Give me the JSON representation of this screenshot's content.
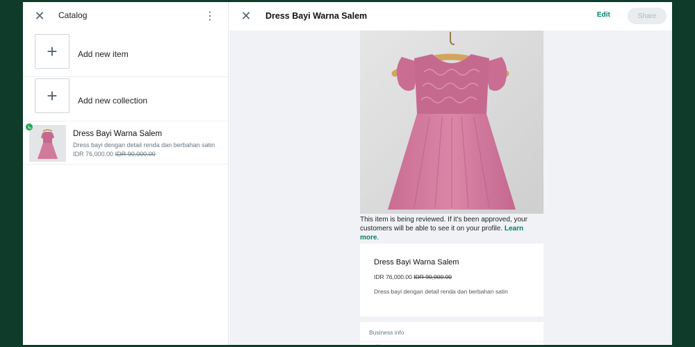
{
  "catalog": {
    "title": "Catalog",
    "add_item_label": "Add new item",
    "add_collection_label": "Add new collection",
    "items": [
      {
        "name": "Dress Bayi Warna Salem",
        "description": "Dress bayi dengan detail renda dan berbahan satin",
        "price": "IDR 76,000.00",
        "original_price": "IDR 90,000.00",
        "status": "under-review"
      }
    ]
  },
  "detail": {
    "title": "Dress Bayi Warna Salem",
    "edit_label": "Edit",
    "share_label": "Share",
    "review_notice": "This item is being reviewed. If it's been approved, your customers will be able to see it on your profile.",
    "learn_more": "Learn more",
    "notice_end": ".",
    "product_name": "Dress Bayi Warna Salem",
    "price": "IDR 76,000.00",
    "original_price": "IDR 90,000.00",
    "description": "Dress bayi dengan detail renda dan berbahan satin",
    "business_info_label": "Business info"
  },
  "colors": {
    "accent": "#008069",
    "status_badge": "#1fa855",
    "dress": "#d27a9c",
    "background_frame": "#0f3b2a"
  },
  "icons": {
    "close": "close-icon",
    "more": "more-vertical-icon",
    "add": "plus-icon",
    "review": "clock-icon"
  }
}
